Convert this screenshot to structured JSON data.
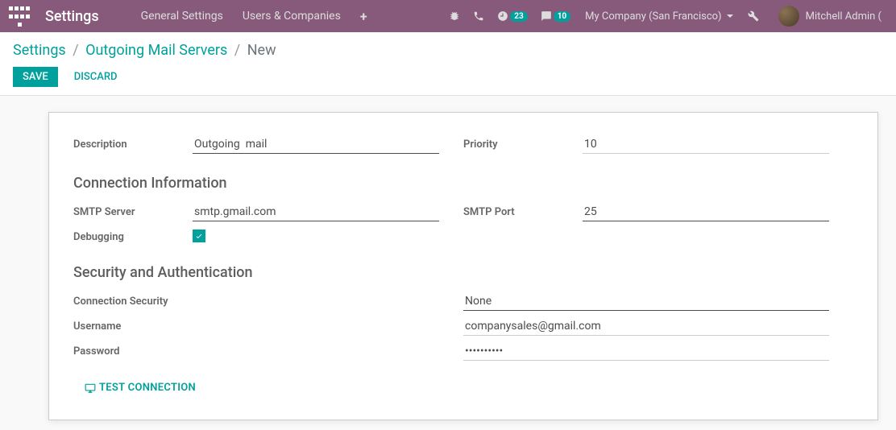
{
  "topbar": {
    "brand": "Settings",
    "nav": {
      "general": "General Settings",
      "users": "Users & Companies"
    },
    "activities_count": "23",
    "messages_count": "10",
    "company": "My Company (San Francisco)",
    "user": "Mitchell Admin ("
  },
  "breadcrumb": {
    "root": "Settings",
    "parent": "Outgoing Mail Servers",
    "current": "New"
  },
  "buttons": {
    "save": "Save",
    "discard": "Discard",
    "test_connection": "Test Connection"
  },
  "labels": {
    "description": "Description",
    "priority": "Priority",
    "section_connection": "Connection Information",
    "smtp_server": "SMTP Server",
    "smtp_port": "SMTP Port",
    "debugging": "Debugging",
    "section_security": "Security and Authentication",
    "connection_security": "Connection Security",
    "username": "Username",
    "password": "Password"
  },
  "values": {
    "description": "Outgoing  mail",
    "priority": "10",
    "smtp_server": "smtp.gmail.com",
    "smtp_port": "25",
    "debugging": true,
    "connection_security": "None",
    "username": "companysales@gmail.com",
    "password": "••••••••••"
  }
}
